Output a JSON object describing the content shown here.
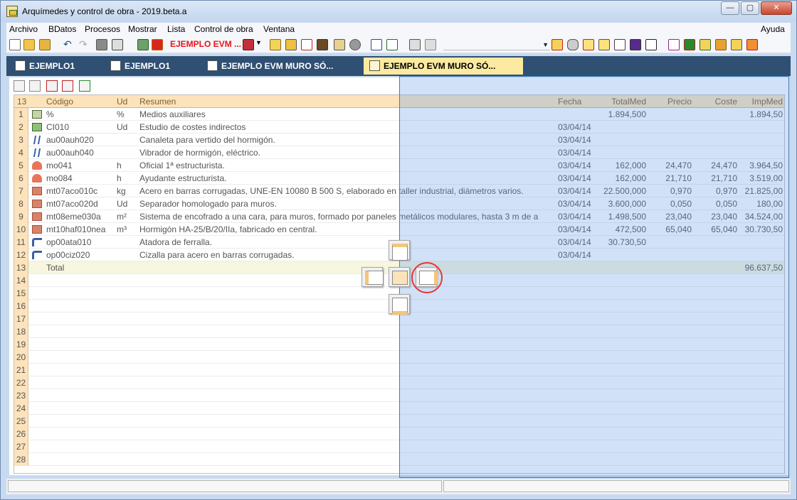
{
  "window": {
    "title": "Arquímedes y control de obra - 2019.beta.a",
    "minimize": "—",
    "maximize": "▢",
    "close": "✕"
  },
  "menu": {
    "items": [
      "Archivo",
      "BDatos",
      "Procesos",
      "Mostrar",
      "Lista",
      "Control de obra",
      "Ventana"
    ],
    "help": "Ayuda"
  },
  "toolbar": {
    "project_title": "EJEMPLO EVM ..."
  },
  "tabs": [
    {
      "label": "EJEMPLO1",
      "active": false
    },
    {
      "label": "EJEMPLO1",
      "active": false
    },
    {
      "label": "EJEMPLO EVM MURO SÓ...",
      "active": false
    },
    {
      "label": "EJEMPLO EVM MURO SÓ...",
      "active": true
    }
  ],
  "grid": {
    "row_count": "13",
    "columns": [
      "Código",
      "Ud",
      "Resumen",
      "Fecha",
      "TotalMed",
      "Precio",
      "Coste",
      "ImpMed"
    ],
    "rows": [
      {
        "n": "1",
        "icon": "percent-icon",
        "codigo": "%",
        "ud": "%",
        "resumen": "Medios auxiliares",
        "fecha": "",
        "totalmed": "1.894,500",
        "precio": "",
        "coste": "",
        "impmed": "1.894,50"
      },
      {
        "n": "2",
        "icon": "indirect-cost-icon",
        "codigo": "CI010",
        "ud": "Ud",
        "resumen": "Estudio de costes indirectos",
        "fecha": "03/04/14",
        "totalmed": "",
        "precio": "",
        "coste": "",
        "impmed": ""
      },
      {
        "n": "3",
        "icon": "compass-icon",
        "codigo": "au00auh020",
        "ud": "",
        "resumen": "Canaleta para vertido del hormigón.",
        "fecha": "03/04/14",
        "totalmed": "",
        "precio": "",
        "coste": "",
        "impmed": ""
      },
      {
        "n": "4",
        "icon": "compass-icon",
        "codigo": "au00auh040",
        "ud": "",
        "resumen": "Vibrador de hormigón, eléctrico.",
        "fecha": "03/04/14",
        "totalmed": "",
        "precio": "",
        "coste": "",
        "impmed": ""
      },
      {
        "n": "5",
        "icon": "hardhat-icon",
        "codigo": "mo041",
        "ud": "h",
        "resumen": "Oficial 1ª estructurista.",
        "fecha": "03/04/14",
        "totalmed": "162,000",
        "precio": "24,470",
        "coste": "24,470",
        "impmed": "3.964,50"
      },
      {
        "n": "6",
        "icon": "hardhat-icon",
        "codigo": "mo084",
        "ud": "h",
        "resumen": "Ayudante estructurista.",
        "fecha": "03/04/14",
        "totalmed": "162,000",
        "precio": "21,710",
        "coste": "21,710",
        "impmed": "3.519,00"
      },
      {
        "n": "7",
        "icon": "brick-icon",
        "codigo": "mt07aco010c",
        "ud": "kg",
        "resumen": "Acero en barras corrugadas, UNE-EN 10080 B 500 S, elaborado en taller industrial, diámetros varios.",
        "fecha": "03/04/14",
        "totalmed": "22.500,000",
        "precio": "0,970",
        "coste": "0,970",
        "impmed": "21.825,00"
      },
      {
        "n": "8",
        "icon": "brick-icon",
        "codigo": "mt07aco020d",
        "ud": "Ud",
        "resumen": "Separador homologado para muros.",
        "fecha": "03/04/14",
        "totalmed": "3.600,000",
        "precio": "0,050",
        "coste": "0,050",
        "impmed": "180,00"
      },
      {
        "n": "9",
        "icon": "brick-icon",
        "codigo": "mt08eme030a",
        "ud": "m²",
        "resumen": "Sistema de encofrado a una cara, para muros, formado por paneles metálicos modulares, hasta 3 m de a",
        "fecha": "03/04/14",
        "totalmed": "1.498,500",
        "precio": "23,040",
        "coste": "23,040",
        "impmed": "34.524,00"
      },
      {
        "n": "10",
        "icon": "brick-icon",
        "codigo": "mt10haf010nea",
        "ud": "m³",
        "resumen": "Hormigón HA-25/B/20/IIa, fabricado en central.",
        "fecha": "03/04/14",
        "totalmed": "472,500",
        "precio": "65,040",
        "coste": "65,040",
        "impmed": "30.730,50"
      },
      {
        "n": "11",
        "icon": "tool-icon",
        "codigo": "op00ata010",
        "ud": "",
        "resumen": "Atadora de ferralla.",
        "fecha": "03/04/14",
        "totalmed": "30.730,50",
        "precio": "",
        "coste": "",
        "impmed": ""
      },
      {
        "n": "12",
        "icon": "tool-icon",
        "codigo": "op00ciz020",
        "ud": "",
        "resumen": "Cizalla para acero en barras corrugadas.",
        "fecha": "03/04/14",
        "totalmed": "",
        "precio": "",
        "coste": "",
        "impmed": ""
      },
      {
        "n": "13",
        "icon": "",
        "codigo": "Total",
        "ud": "",
        "resumen": "",
        "fecha": "",
        "totalmed": "",
        "precio": "",
        "coste": "",
        "impmed": "96.637,50"
      }
    ],
    "empty_rows": [
      "14",
      "15",
      "16",
      "17",
      "18",
      "19",
      "20",
      "21",
      "22",
      "23",
      "24",
      "25",
      "26",
      "27",
      "28"
    ]
  },
  "colors": {
    "header_bg": "#fde3bb",
    "dock_overlay": "#5a96e6",
    "tab_bar": "#2f4f73",
    "active_tab": "#fbeaa0",
    "highlight_circle": "#e33333"
  }
}
